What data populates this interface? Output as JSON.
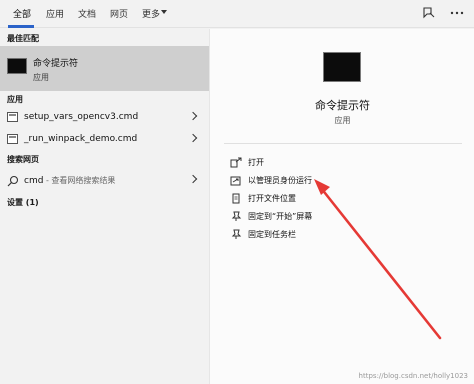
{
  "tabs": [
    {
      "label": "全部"
    },
    {
      "label": "应用"
    },
    {
      "label": "文档"
    },
    {
      "label": "网页"
    },
    {
      "label": "更多"
    }
  ],
  "left": {
    "best_match_heading": "最佳匹配",
    "best_match": {
      "title": "命令提示符",
      "subtitle": "应用"
    },
    "apps_heading": "应用",
    "apps": [
      {
        "label": "setup_vars_opencv3.cmd"
      },
      {
        "label": "_run_winpack_demo.cmd"
      }
    ],
    "web_heading": "搜索网页",
    "web_item": {
      "query": "cmd",
      "suffix": " - 查看网络搜索结果"
    },
    "settings_heading": "设置 (1)"
  },
  "right": {
    "title": "命令提示符",
    "subtitle": "应用",
    "actions": [
      {
        "label": "打开",
        "icon": "open-icon"
      },
      {
        "label": "以管理员身份运行",
        "icon": "run-as-admin-icon"
      },
      {
        "label": "打开文件位置",
        "icon": "file-location-icon"
      },
      {
        "label": "固定到“开始”屏幕",
        "icon": "pin-start-icon"
      },
      {
        "label": "固定到任务栏",
        "icon": "pin-taskbar-icon"
      }
    ]
  },
  "watermark": "https://blog.csdn.net/holly1023",
  "colors": {
    "accent": "#2b63c9",
    "selected_bg": "#cfcfcf",
    "annotation_arrow": "#e53935"
  }
}
